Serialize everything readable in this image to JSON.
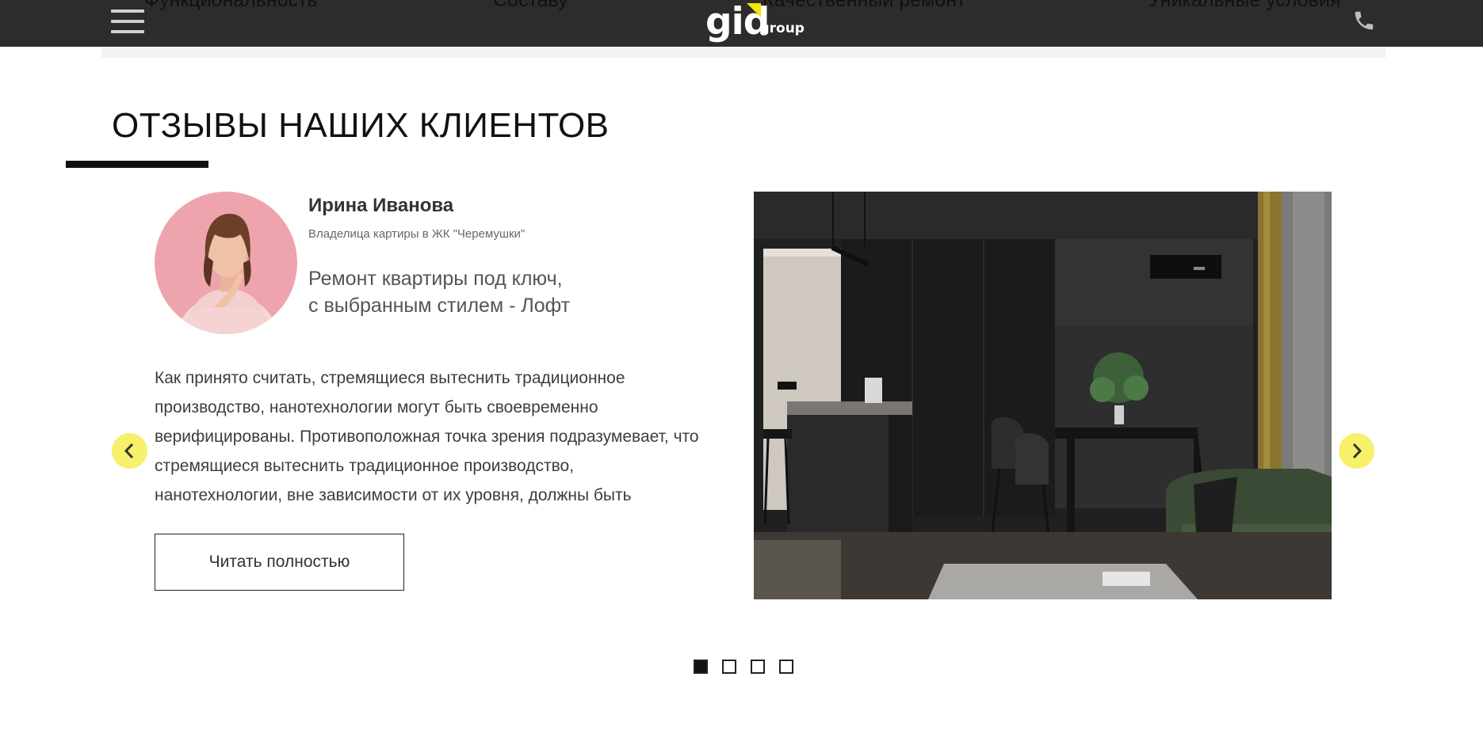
{
  "header": {
    "nav": [
      "Функциональность",
      "Составу",
      "Качественный ремонт",
      "Уникальные условия"
    ],
    "logo_text": "gid",
    "logo_suffix": ".group",
    "logo_accent": "#f3e600",
    "menu_icon": "hamburger-icon",
    "phone_icon": "phone-icon"
  },
  "section": {
    "title": "ОТЗЫВЫ НАШИХ КЛИЕНТОВ"
  },
  "review": {
    "name": "Ирина Иванова",
    "role": "Владелица картиры в ЖК \"Черемушки\"",
    "headline_lines": [
      "Ремонт квартиры под ключ,",
      "с выбранным стилем - Лофт"
    ],
    "text_lines": [
      "Как принято считать, стремящиеся вытеснить традиционное",
      "производство, нанотехнологии могут быть своевременно",
      "верифицированы. Противоположная точка зрения подразумевает, что",
      "стремящиеся вытеснить традиционное производство,",
      "нанотехнологии, вне зависимости от их уровня, должны быть"
    ],
    "button_label": "Читать полностью"
  },
  "carousel": {
    "prev_icon": "chevron-left-icon",
    "next_icon": "chevron-right-icon",
    "accent": "#f7f06b",
    "pages": 4,
    "active_page": 1
  }
}
